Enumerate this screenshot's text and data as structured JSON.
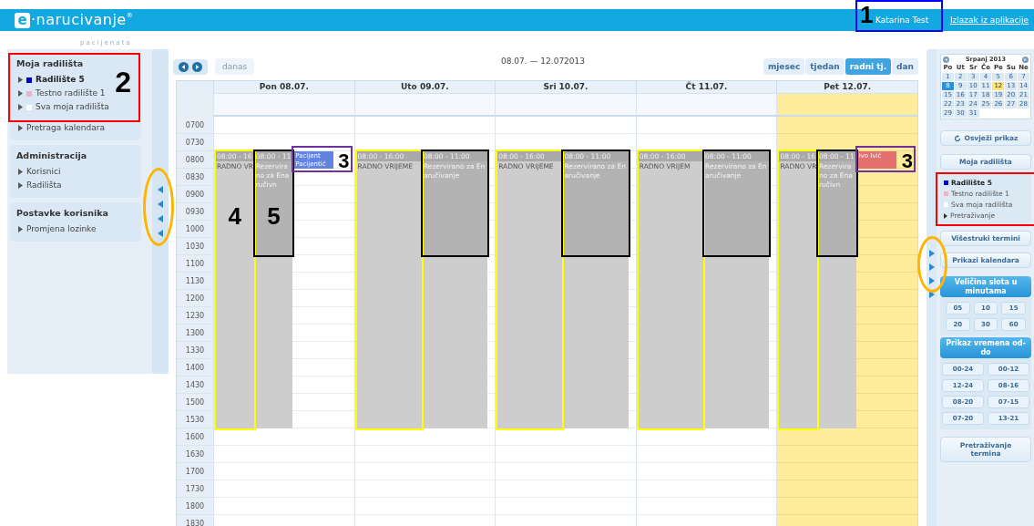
{
  "header": {
    "logo": {
      "mark": "e",
      "text": "·narucivanje",
      "reg": "®",
      "sub": "pacijenata"
    },
    "user": "Katarina Test",
    "logout": "Izlazak iz aplikacije",
    "user_marker": {
      "color": "#0000ff",
      "number": "1"
    }
  },
  "left_sidebar": {
    "panels": [
      {
        "title": "Moja radilišta",
        "items": [
          {
            "label": "Radilište 5",
            "color": "#0000cc",
            "selected": true
          },
          {
            "label": "Testno radilište 1",
            "color": "#e8b4c8",
            "selected": false
          },
          {
            "label": "Sva moja radilišta",
            "color": "#ffffff",
            "selected": false
          }
        ],
        "marker": {
          "color": "#ff0000",
          "number": "2"
        },
        "links": [
          "Pretraga kalendara"
        ]
      },
      {
        "title": "Administracija",
        "links": [
          "Korisnici",
          "Radilišta"
        ]
      },
      {
        "title": "Postavke korisnika",
        "links": [
          "Promjena lozinke"
        ]
      }
    ],
    "collapse_marker": {
      "color": "#ffb400"
    }
  },
  "calendar": {
    "today_button": "danas",
    "today_disabled": true,
    "title": "08.07. — 12.072013",
    "views": [
      {
        "label": "mjesec",
        "selected": false
      },
      {
        "label": "tjedan",
        "selected": false
      },
      {
        "label": "radni tj.",
        "selected": true
      },
      {
        "label": "dan",
        "selected": false
      }
    ],
    "times": [
      "0700",
      "0730",
      "0800",
      "0830",
      "0900",
      "0930",
      "1000",
      "1030",
      "1100",
      "1130",
      "1200",
      "1230",
      "1300",
      "1330",
      "1400",
      "1430",
      "1500",
      "1530",
      "1600",
      "1630",
      "1700",
      "1730",
      "1800",
      "1830"
    ],
    "days": [
      {
        "label": "Pon 08.07.",
        "today": false,
        "lanes": [
          [
            {
              "kind": "working",
              "time": "08:00 - 16",
              "title": "RADNO VR",
              "marker": {
                "color": "#ffff00",
                "number": "4"
              }
            }
          ],
          [
            {
              "kind": "reserved",
              "time": "08:00 - 11",
              "title": "Rezervirano za Enaručivn",
              "marker": {
                "color": "#000000",
                "number": "5"
              }
            },
            {
              "kind": "free"
            }
          ],
          [
            {
              "kind": "patient",
              "title": "Pacijent Pacijentić",
              "color": "#6283e0",
              "marker": {
                "color": "#7030a0",
                "number": "3"
              }
            }
          ]
        ]
      },
      {
        "label": "Uto 09.07.",
        "today": false,
        "lanes": [
          [
            {
              "kind": "working",
              "time": "08:00 - 16:00",
              "title": "RADNO VRIJEME",
              "marker": {
                "color": "#ffff00"
              }
            }
          ],
          [
            {
              "kind": "reserved",
              "time": "08:00 - 11:00",
              "title": "Rezervirano za Enaručivanje",
              "marker": {
                "color": "#000000"
              }
            },
            {
              "kind": "free"
            }
          ]
        ]
      },
      {
        "label": "Sri 10.07.",
        "today": false,
        "lanes": [
          [
            {
              "kind": "working",
              "time": "08:00 - 16:00",
              "title": "RADNO VRIJEME",
              "marker": {
                "color": "#ffff00"
              }
            }
          ],
          [
            {
              "kind": "reserved",
              "time": "08:00 - 11:00",
              "title": "Rezervirano za Enaručivanje",
              "marker": {
                "color": "#000000"
              }
            },
            {
              "kind": "free"
            }
          ]
        ]
      },
      {
        "label": "Čt 11.07.",
        "today": false,
        "lanes": [
          [
            {
              "kind": "working",
              "time": "08:00 - 16:00",
              "title": "RADNO VRIJEM",
              "marker": {
                "color": "#ffff00"
              }
            }
          ],
          [
            {
              "kind": "reserved",
              "time": "08:00 - 11:00",
              "title": "Rezervirano za Enaručivanje",
              "marker": {
                "color": "#000000"
              }
            },
            {
              "kind": "free"
            }
          ]
        ]
      },
      {
        "label": "Pet 12.07.",
        "today": true,
        "lanes": [
          [
            {
              "kind": "working",
              "time": "08:00 - 16",
              "title": "RADNO VR",
              "marker": {
                "color": "#ffff00"
              }
            }
          ],
          [
            {
              "kind": "reserved",
              "time": "08:00 - 11",
              "title": "Rezervirano za Enaručivn",
              "marker": {
                "color": "#000000"
              }
            },
            {
              "kind": "free"
            }
          ],
          [
            {
              "kind": "patient",
              "title": "Ivo Ivić",
              "color": "#e46f6f",
              "marker": {
                "color": "#7030a0",
                "number": "3"
              }
            }
          ]
        ]
      }
    ]
  },
  "right_sidebar": {
    "mini_calendar": {
      "title": "Srpanj 2013",
      "weekdays": [
        "Po",
        "Ut",
        "Sr",
        "Če",
        "Pe",
        "Su",
        "Ne"
      ],
      "days": [
        {
          "label": "1",
          "selected": false,
          "today": false
        },
        {
          "label": "2",
          "selected": false,
          "today": false
        },
        {
          "label": "3",
          "selected": false,
          "today": false
        },
        {
          "label": "4",
          "selected": false,
          "today": false
        },
        {
          "label": "5",
          "selected": false,
          "today": false
        },
        {
          "label": "6",
          "selected": false,
          "today": false
        },
        {
          "label": "7",
          "selected": false,
          "today": false
        },
        {
          "label": "8",
          "selected": true,
          "today": false
        },
        {
          "label": "9",
          "selected": false,
          "today": false
        },
        {
          "label": "10",
          "selected": false,
          "today": false
        },
        {
          "label": "11",
          "selected": false,
          "today": false
        },
        {
          "label": "12",
          "selected": false,
          "today": true
        },
        {
          "label": "13",
          "selected": false,
          "today": false
        },
        {
          "label": "14",
          "selected": false,
          "today": false
        },
        {
          "label": "15",
          "selected": false,
          "today": false
        },
        {
          "label": "16",
          "selected": false,
          "today": false
        },
        {
          "label": "17",
          "selected": false,
          "today": false
        },
        {
          "label": "18",
          "selected": false,
          "today": false
        },
        {
          "label": "19",
          "selected": false,
          "today": false
        },
        {
          "label": "20",
          "selected": false,
          "today": false
        },
        {
          "label": "21",
          "selected": false,
          "today": false
        },
        {
          "label": "22",
          "selected": false,
          "today": false
        },
        {
          "label": "23",
          "selected": false,
          "today": false
        },
        {
          "label": "24",
          "selected": false,
          "today": false
        },
        {
          "label": "25",
          "selected": false,
          "today": false
        },
        {
          "label": "26",
          "selected": false,
          "today": false
        },
        {
          "label": "27",
          "selected": false,
          "today": false
        },
        {
          "label": "28",
          "selected": false,
          "today": false
        },
        {
          "label": "29",
          "selected": false,
          "today": false
        },
        {
          "label": "30",
          "selected": false,
          "today": false
        },
        {
          "label": "31",
          "selected": false,
          "today": false
        }
      ]
    },
    "refresh_button": "Osvježi prikaz",
    "sites_button": "Moja radilišta",
    "sites": {
      "items": [
        {
          "label": "Radilište 5",
          "color": "#0000cc",
          "selected": true
        },
        {
          "label": "Testno radilište 1",
          "color": "#e8b4c8",
          "selected": false
        },
        {
          "label": "Sva moja radilišta",
          "color": "#ffffff",
          "selected": false
        }
      ],
      "search": "Pretraživanje",
      "marker": {
        "color": "#ff0000"
      }
    },
    "buttons": [
      "Višestruki termini",
      "Prikazi kalendara"
    ],
    "slot": {
      "title": "Veličina slota u minutama",
      "options": [
        "05",
        "10",
        "15",
        "20",
        "30",
        "60"
      ]
    },
    "range": {
      "title": "Prikaz vremena od-do",
      "options": [
        "00-24",
        "00-12",
        "12-24",
        "08-16",
        "08-20",
        "07-15",
        "07-20",
        "13-21"
      ]
    },
    "search_button": "Pretraživanje termina",
    "collapse_marker": {
      "color": "#ffb400"
    }
  }
}
